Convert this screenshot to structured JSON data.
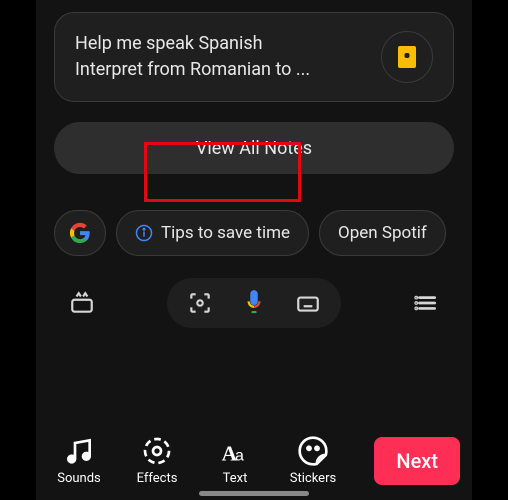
{
  "suggestion": {
    "line1": "Help me speak Spanish",
    "line2": "Interpret from Romanian to ..."
  },
  "view_all_label": "View All Notes",
  "chips": {
    "tips": "Tips to save time",
    "spotify": "Open Spotif"
  },
  "bottom": {
    "sounds": "Sounds",
    "effects": "Effects",
    "text": "Text",
    "stickers": "Stickers"
  },
  "next_label": "Next"
}
